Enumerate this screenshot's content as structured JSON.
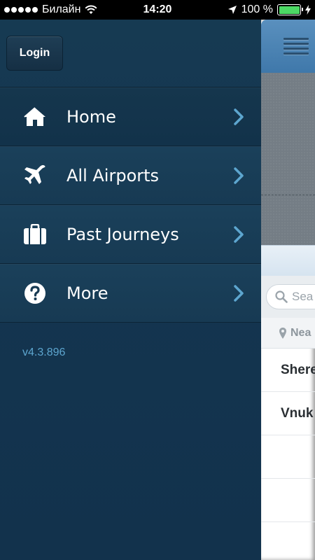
{
  "status_bar": {
    "carrier": "Билайн",
    "time": "14:20",
    "battery": "100 %",
    "battery_level": 1.0
  },
  "menu": {
    "login_label": "Login",
    "items": [
      {
        "label": "Home",
        "icon": "home-icon"
      },
      {
        "label": "All Airports",
        "icon": "airplane-icon"
      },
      {
        "label": "Past Journeys",
        "icon": "briefcase-icon"
      },
      {
        "label": "More",
        "icon": "question-icon"
      }
    ],
    "version": "v4.3.896"
  },
  "peek": {
    "search_placeholder": "Sea",
    "near_label": "Nea",
    "rows": [
      "Shere",
      "Vnuk"
    ]
  },
  "colors": {
    "menu_bg": "#163a52",
    "version_text": "#5da6cf",
    "battery_fill": "#4cd964",
    "header_blue": "#4a83b3"
  }
}
